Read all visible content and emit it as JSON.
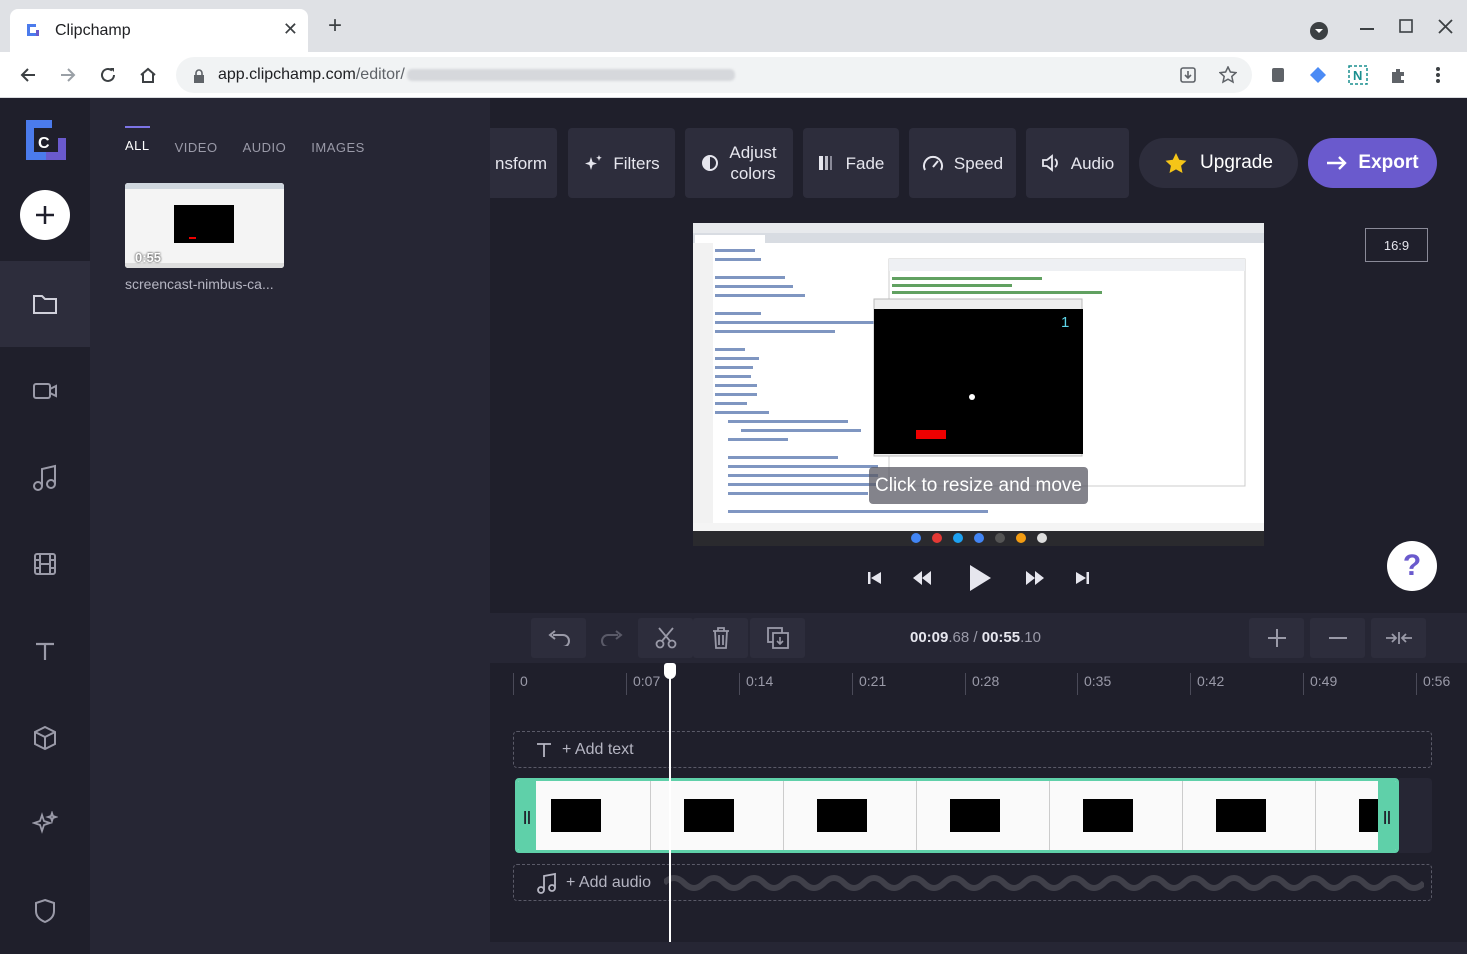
{
  "browser": {
    "tab_title": "Clipchamp",
    "url_host": "app.clipchamp.com",
    "url_path": "/editor/"
  },
  "library": {
    "tabs": [
      "ALL",
      "VIDEO",
      "AUDIO",
      "IMAGES"
    ],
    "active_tab": "ALL",
    "media": [
      {
        "name": "screencast-nimbus-ca...",
        "duration": "0:55"
      }
    ]
  },
  "toolbar": {
    "transform": "nsform",
    "filters": "Filters",
    "adjust_line1": "Adjust",
    "adjust_line2": "colors",
    "fade": "Fade",
    "speed": "Speed",
    "audio": "Audio",
    "upgrade": "Upgrade",
    "export": "Export"
  },
  "preview": {
    "aspect_ratio": "16:9",
    "overlay_hint": "Click to resize and move",
    "game_score": "1"
  },
  "timeline": {
    "current_time": "00:09",
    "current_frac": ".68",
    "separator": " / ",
    "total_time": "00:55",
    "total_frac": ".10",
    "ruler": [
      "0",
      "0:07",
      "0:14",
      "0:21",
      "0:28",
      "0:35",
      "0:42",
      "0:49",
      "0:56"
    ],
    "add_text": "+ Add text",
    "add_audio": "+ Add audio"
  },
  "colors": {
    "accent": "#6a5acd",
    "clip_border": "#5fd0a9",
    "background": "#1f1f2b",
    "panel": "#262634"
  }
}
